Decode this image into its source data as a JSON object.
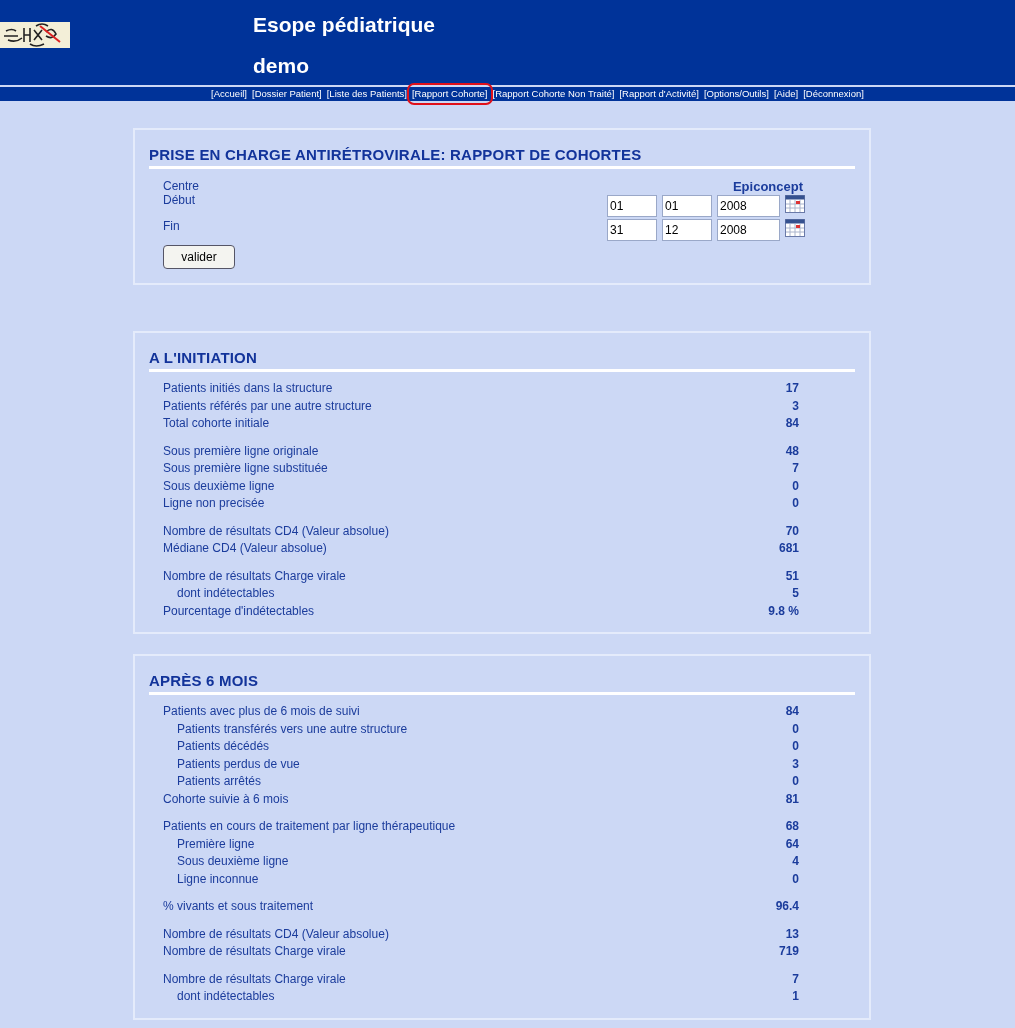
{
  "header": {
    "title": "Esope pédiatrique",
    "subtitle": "demo"
  },
  "nav": [
    {
      "label": "[Accueil]",
      "selected": false
    },
    {
      "label": "[Dossier Patient]",
      "selected": false
    },
    {
      "label": "[Liste des Patients]",
      "selected": false
    },
    {
      "label": "[Rapport Cohorte]",
      "selected": true
    },
    {
      "label": "[Rapport Cohorte Non Traité]",
      "selected": false
    },
    {
      "label": "[Rapport d'Activité]",
      "selected": false
    },
    {
      "label": "[Options/Outils]",
      "selected": false
    },
    {
      "label": "[Aide]",
      "selected": false
    },
    {
      "label": "[Déconnexion]",
      "selected": false
    }
  ],
  "form": {
    "title": "PRISE EN CHARGE ANTIRÉTROVIRALE: RAPPORT DE COHORTES",
    "centre_label": "Centre",
    "centre_value": "Epiconcept",
    "start_label": "Début",
    "start": [
      "01",
      "01",
      "2008"
    ],
    "end_label": "Fin",
    "end": [
      "31",
      "12",
      "2008"
    ],
    "submit": "valider"
  },
  "sections": [
    {
      "title": "A L'INITIATION",
      "groups": [
        [
          {
            "label": "Patients initiés dans la structure",
            "value": "17"
          },
          {
            "label": "Patients référés par une autre structure",
            "value": "3"
          },
          {
            "label": "Total cohorte initiale",
            "value": "84"
          }
        ],
        [
          {
            "label": "Sous première ligne originale",
            "value": "48"
          },
          {
            "label": "Sous première ligne substituée",
            "value": "7"
          },
          {
            "label": "Sous deuxième ligne",
            "value": "0"
          },
          {
            "label": "Ligne non precisée",
            "value": "0"
          }
        ],
        [
          {
            "label": "Nombre de résultats CD4 (Valeur absolue)",
            "value": "70"
          },
          {
            "label": "Médiane CD4 (Valeur absolue)",
            "value": "681"
          }
        ],
        [
          {
            "label": "Nombre de résultats Charge virale",
            "value": "51",
            "children": [
              {
                "label": "dont indétectables",
                "value": "5"
              }
            ]
          },
          {
            "label": "Pourcentage d'indétectables",
            "value": "9.8 %"
          }
        ]
      ]
    },
    {
      "title": "APRÈS 6 MOIS",
      "groups": [
        [
          {
            "label": "Patients avec plus de 6 mois de suivi",
            "value": "84",
            "children": [
              {
                "label": "Patients transférés vers une autre structure",
                "value": "0"
              },
              {
                "label": "Patients décédés",
                "value": "0"
              },
              {
                "label": "Patients perdus de vue",
                "value": "3"
              },
              {
                "label": "Patients arrêtés",
                "value": "0"
              }
            ]
          },
          {
            "label": "Cohorte suivie à 6 mois",
            "value": "81"
          }
        ],
        [
          {
            "label": "Patients en cours de traitement par ligne thérapeutique",
            "value": "68",
            "children": [
              {
                "label": "Première ligne",
                "value": "64"
              },
              {
                "label": "Sous deuxième ligne",
                "value": "4"
              },
              {
                "label": "Ligne inconnue",
                "value": "0"
              }
            ]
          }
        ],
        [
          {
            "label": "% vivants et sous traitement",
            "value": "96.4"
          }
        ],
        [
          {
            "label": "Nombre de résultats CD4 (Valeur absolue)",
            "value": "13"
          },
          {
            "label": "Nombre de résultats Charge virale",
            "value": "719"
          }
        ],
        [
          {
            "label": "Nombre de résultats Charge virale",
            "value": "7",
            "children": [
              {
                "label": "dont indétectables",
                "value": "1"
              }
            ]
          }
        ]
      ]
    }
  ]
}
